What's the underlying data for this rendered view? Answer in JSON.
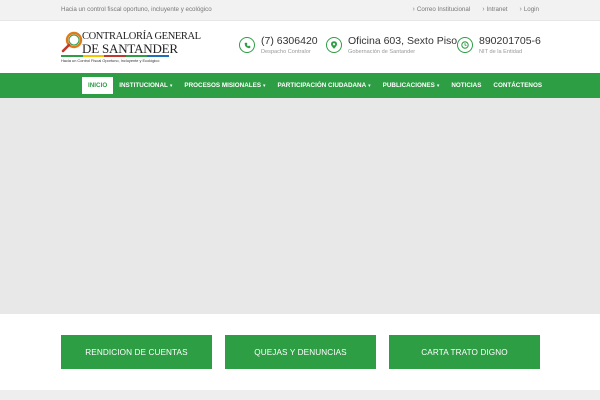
{
  "topbar": {
    "tagline": "Hacia un control fiscal oportuno, incluyente y ecológico",
    "links": [
      "Correo Institucional",
      "Intranet",
      "Login"
    ]
  },
  "logo": {
    "line1": "CONTRALORÍA GENERAL",
    "line2": "DE SANTANDER",
    "line3": "Hacia un Control Fiscal Oportuno, Incluyente y Ecológico"
  },
  "contacts": [
    {
      "icon": "phone-icon",
      "value": "(7) 6306420",
      "sub": "Despacho Contralor"
    },
    {
      "icon": "location-pin-icon",
      "value": "Oficina 603, Sexto Piso",
      "sub": "Gobernación de Santander"
    },
    {
      "icon": "clock-icon",
      "value": "890201705-6",
      "sub": "NIT de la Entidad"
    }
  ],
  "nav": {
    "items": [
      {
        "label": "INICIO",
        "caret": ""
      },
      {
        "label": "INSTITUCIONAL",
        "caret": "▾"
      },
      {
        "label": "PROCESOS MISIONALES",
        "caret": "▾"
      },
      {
        "label": "PARTICIPACIÓN CIUDADANA",
        "caret": "▾"
      },
      {
        "label": "PUBLICACIONES",
        "caret": "▾"
      },
      {
        "label": "NOTICIAS",
        "caret": ""
      },
      {
        "label": "CONTÁCTENOS",
        "caret": ""
      }
    ]
  },
  "actions": [
    "RENDICION DE CUENTAS",
    "QUEJAS Y DENUNCIAS",
    "CARTA TRATO DIGNO"
  ],
  "colors": {
    "brand_green": "#2e9e45",
    "hero_bg": "#e8e8e8"
  }
}
